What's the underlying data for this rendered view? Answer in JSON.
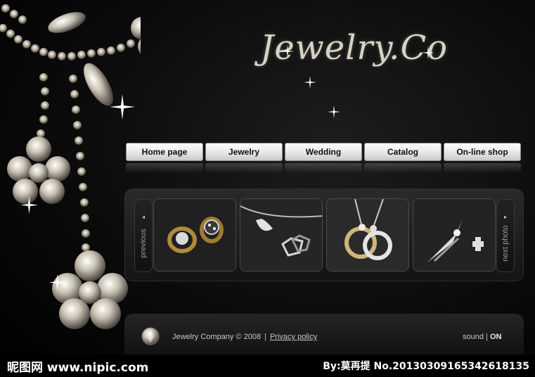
{
  "logo": {
    "text": "Jewelry.Co"
  },
  "nav": {
    "items": [
      {
        "label": "Home page"
      },
      {
        "label": "Jewelry"
      },
      {
        "label": "Wedding"
      },
      {
        "label": "Catalog"
      },
      {
        "label": "On-line shop"
      }
    ]
  },
  "gallery": {
    "prev_label": "previous",
    "next_label": "next photo",
    "prev_arrow": "◂",
    "next_arrow": "▸"
  },
  "footer": {
    "company": "Jewelry Company © 2008",
    "separator": "|",
    "privacy": "Privacy policy",
    "sound_label": "sound",
    "sound_state": "ON"
  },
  "watermark": {
    "left": "昵图网 www.nipic.com",
    "right": "By:莫再提 No.20130309165342618135"
  },
  "colors": {
    "background": "#000000",
    "nav_button": "#e6e6e6",
    "logo": "#d8d2c4",
    "footer_text": "#c8c8c8"
  },
  "icons": [
    "diamond-necklace-art",
    "sparkle-icon",
    "gem-icon",
    "arrow-left-icon",
    "arrow-right-icon"
  ]
}
